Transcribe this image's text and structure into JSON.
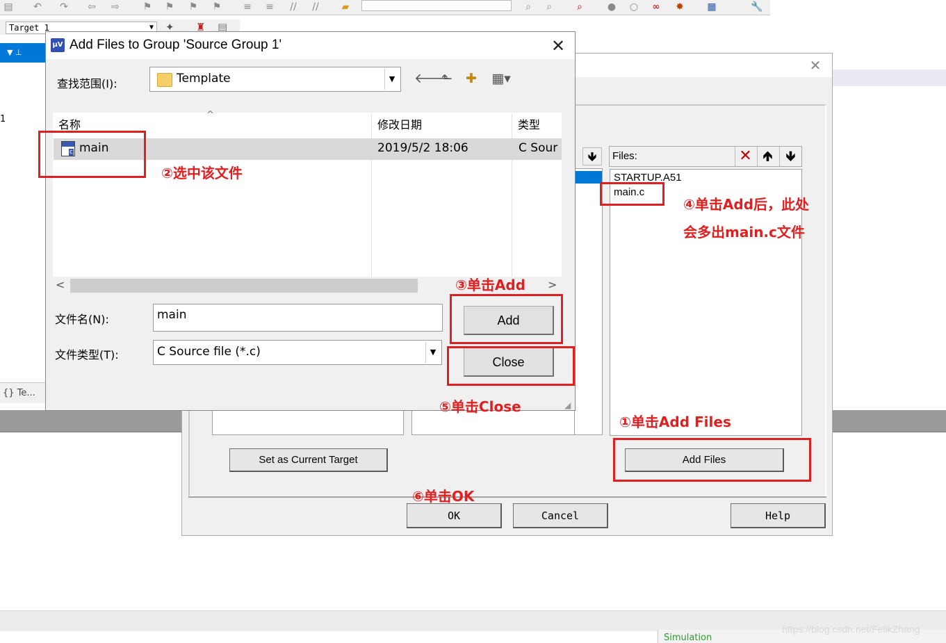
{
  "ide": {
    "target_combo": "Target 1",
    "left_number": "1",
    "left_tab": "Te...",
    "status_tab": "Simulation"
  },
  "manage_dialog": {
    "files_label": "Files:",
    "files": [
      "STARTUP.A51",
      "main.c"
    ],
    "set_target_button": "Set as Current Target",
    "add_files_button": "Add Files",
    "ok_button": "OK",
    "cancel_button": "Cancel",
    "help_button": "Help"
  },
  "add_dialog": {
    "title": "Add Files to Group 'Source Group 1'",
    "look_in_label": "查找范围(I):",
    "look_in_value": "Template",
    "columns": [
      "名称",
      "修改日期",
      "类型"
    ],
    "file_row": {
      "name": "main",
      "date": "2019/5/2 18:06",
      "type": "C Sour"
    },
    "filename_label": "文件名(N):",
    "filename_value": "main",
    "filetype_label": "文件类型(T):",
    "filetype_value": "C Source file (*.c)",
    "add_button": "Add",
    "close_button": "Close"
  },
  "annotations": {
    "step1": "①单击Add Files",
    "step2": "②选中该文件",
    "step3": "③单击Add",
    "step4_line1": "④单击Add后，此处",
    "step4_line2": "会多出main.c文件",
    "step5": "⑤单击Close",
    "step6": "⑥单击OK"
  },
  "watermark": "https://blog.csdn.net/FelikZhang",
  "colors": {
    "annotation_red": "#e02020",
    "selection_blue": "#0078d7"
  }
}
